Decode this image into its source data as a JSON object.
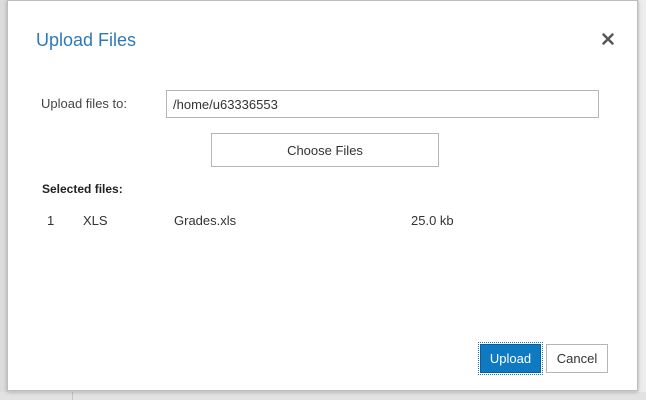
{
  "dialog": {
    "title": "Upload Files",
    "close_icon": "close-icon"
  },
  "form": {
    "upload_to_label": "Upload files to:",
    "upload_to_value": "/home/u63336553",
    "choose_button_label": "Choose Files"
  },
  "selected_files": {
    "heading": "Selected files:",
    "rows": [
      {
        "index": "1",
        "type": "XLS",
        "name": "Grades.xls",
        "size": "25.0 kb"
      }
    ]
  },
  "footer": {
    "upload_label": "Upload",
    "cancel_label": "Cancel"
  },
  "colors": {
    "title": "#2d7ab8",
    "primary_button": "#0f79c2"
  }
}
